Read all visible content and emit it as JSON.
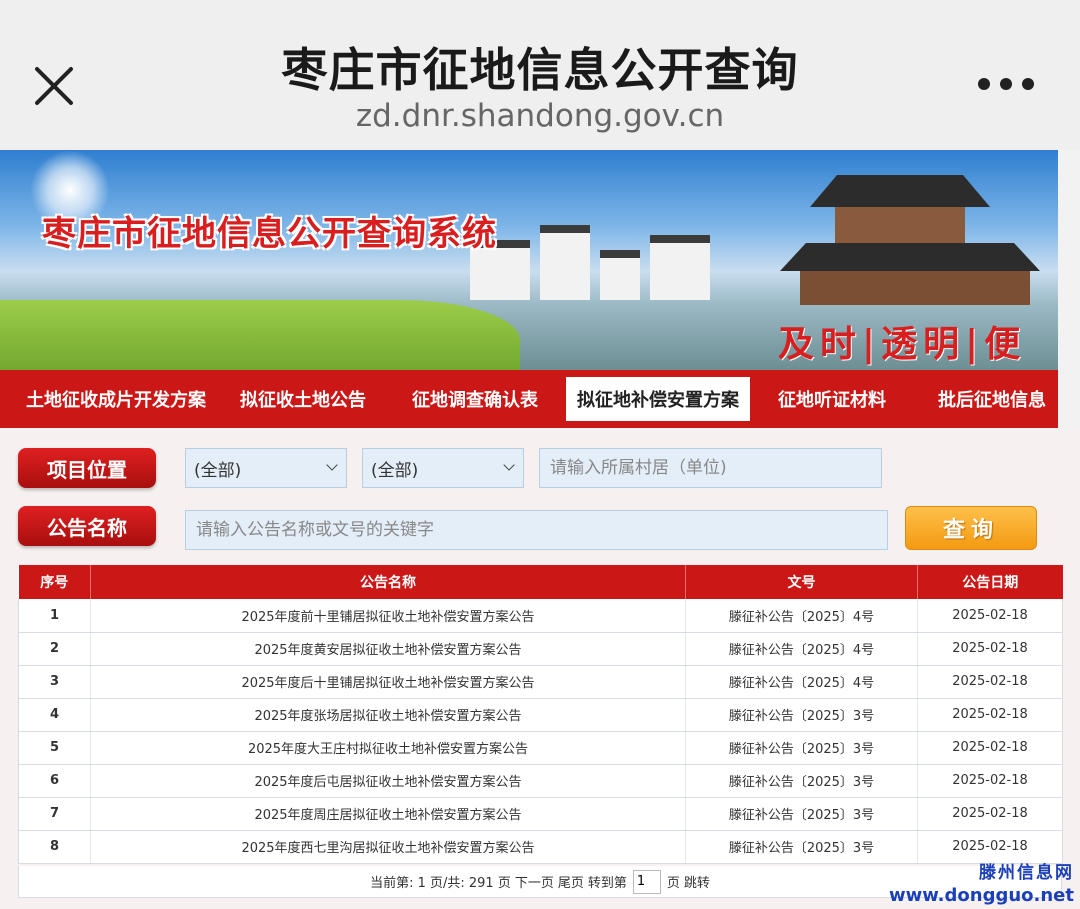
{
  "topbar": {
    "title": "枣庄市征地信息公开查询",
    "url": "zd.dnr.shandong.gov.cn"
  },
  "banner": {
    "title": "枣庄市征地信息公开查询系统",
    "slogan": "及时|透明|便民"
  },
  "nav": {
    "items": [
      {
        "label": "土地征收成片开发方案",
        "active": false
      },
      {
        "label": "拟征收土地公告",
        "active": false
      },
      {
        "label": "征地调查确认表",
        "active": false
      },
      {
        "label": "拟征地补偿安置方案",
        "active": true
      },
      {
        "label": "征地听证材料",
        "active": false
      },
      {
        "label": "批后征地信息",
        "active": false
      }
    ]
  },
  "search": {
    "location_label": "项目位置",
    "select1": "(全部)",
    "select2": "(全部)",
    "village_placeholder": "请输入所属村居（单位)",
    "notice_label": "公告名称",
    "keyword_placeholder": "请输入公告名称或文号的关键字",
    "query_button": "查询"
  },
  "table": {
    "headers": [
      "序号",
      "公告名称",
      "文号",
      "公告日期"
    ],
    "rows": [
      [
        "1",
        "2025年度前十里铺居拟征收土地补偿安置方案公告",
        "滕征补公告〔2025〕4号",
        "2025-02-18"
      ],
      [
        "2",
        "2025年度黄安居拟征收土地补偿安置方案公告",
        "滕征补公告〔2025〕4号",
        "2025-02-18"
      ],
      [
        "3",
        "2025年度后十里铺居拟征收土地补偿安置方案公告",
        "滕征补公告〔2025〕4号",
        "2025-02-18"
      ],
      [
        "4",
        "2025年度张场居拟征收土地补偿安置方案公告",
        "滕征补公告〔2025〕3号",
        "2025-02-18"
      ],
      [
        "5",
        "2025年度大王庄村拟征收土地补偿安置方案公告",
        "滕征补公告〔2025〕3号",
        "2025-02-18"
      ],
      [
        "6",
        "2025年度后屯居拟征收土地补偿安置方案公告",
        "滕征补公告〔2025〕3号",
        "2025-02-18"
      ],
      [
        "7",
        "2025年度周庄居拟征收土地补偿安置方案公告",
        "滕征补公告〔2025〕3号",
        "2025-02-18"
      ],
      [
        "8",
        "2025年度西七里沟居拟征收土地补偿安置方案公告",
        "滕征补公告〔2025〕3号",
        "2025-02-18"
      ]
    ]
  },
  "pager": {
    "current": "当前第: 1 页/共: 291 页",
    "next": "下一页",
    "last": "尾页",
    "goto": "转到第",
    "page_value": "1",
    "page_unit": "页",
    "jump": "跳转"
  },
  "watermark": {
    "line1": "滕州信息网",
    "line2": "www.dongguo.net"
  },
  "colors": {
    "nav_red": "#cc1717",
    "query_orange": "#f39a12",
    "input_blue": "#e3eef8"
  }
}
